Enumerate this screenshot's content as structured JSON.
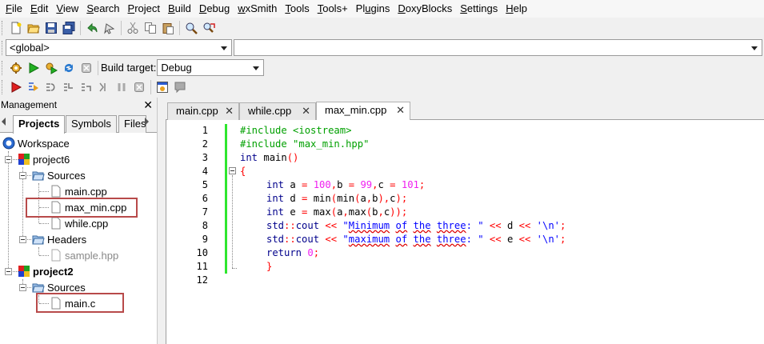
{
  "menubar": [
    "File",
    "Edit",
    "View",
    "Search",
    "Project",
    "Build",
    "Debug",
    "wxSmith",
    "Tools",
    "Tools+",
    "Plugins",
    "DoxyBlocks",
    "Settings",
    "Help"
  ],
  "menubar_underline": [
    "F",
    "E",
    "V",
    "S",
    "P",
    "B",
    "D",
    "w",
    "T",
    "T",
    "u",
    "D",
    "S",
    "H"
  ],
  "scope_combo": "<global>",
  "symbol_combo": "",
  "build_target_label": "Build target:",
  "build_target_value": "Debug",
  "management": {
    "title": "Management",
    "close": "✕",
    "tabs": [
      "Projects",
      "Symbols",
      "Files"
    ],
    "active_tab": "Projects"
  },
  "tree": {
    "workspace": "Workspace",
    "project6": "project6",
    "sources1": "Sources",
    "file_main_cpp": "main.cpp",
    "file_max_min_cpp": "max_min.cpp",
    "file_while_cpp": "while.cpp",
    "headers": "Headers",
    "file_sample_hpp": "sample.hpp",
    "project2": "project2",
    "sources2": "Sources",
    "file_main_c": "main.c"
  },
  "editor_tabs": [
    {
      "label": "main.cpp",
      "active": false
    },
    {
      "label": "while.cpp",
      "active": false
    },
    {
      "label": "max_min.cpp",
      "active": true
    }
  ],
  "tab_close": "✕",
  "line_numbers": [
    "1",
    "2",
    "3",
    "4",
    "5",
    "6",
    "7",
    "8",
    "9",
    "10",
    "11",
    "12"
  ],
  "code": {
    "l1a": "#include ",
    "l1b": "<iostream>",
    "l2a": "#include ",
    "l2b": "\"max_min.hpp\"",
    "l3a": "int",
    "l3b": " main",
    "l3c": "()",
    "l4": "{",
    "l5a": "int",
    "l5b": " a ",
    "l5c": "=",
    "l5d": "100",
    "l5e": ",",
    "l5f": "b ",
    "l5g": "=",
    "l5h": "99",
    "l5i": ",",
    "l5j": "c ",
    "l5k": "=",
    "l5l": "101",
    "l5m": ";",
    "l6a": "int",
    "l6b": " d ",
    "l6c": "=",
    "l6d": " min",
    "l6e": "(",
    "l6f": "min",
    "l6g": "(",
    "l6h": "a",
    "l6i": ",",
    "l6j": "b",
    "l6k": "),",
    "l6l": "c",
    "l6m": ");",
    "l7a": "int",
    "l7b": " e ",
    "l7c": "=",
    "l7d": " max",
    "l7e": "(",
    "l7f": "a",
    "l7g": ",",
    "l7h": "max",
    "l7i": "(",
    "l7j": "b",
    "l7k": ",",
    "l7l": "c",
    "l7m": "));",
    "l8a": "std",
    "l8b": "::",
    "l8c": "cout ",
    "l8d": "<<",
    "l8e": " \"",
    "l8f": "Minimum",
    "l8g": " ",
    "l8h": "of",
    "l8i": " ",
    "l8j": "the",
    "l8k": " ",
    "l8l": "three",
    "l8m": ": \" ",
    "l8n": "<<",
    "l8o": " d ",
    "l8p": "<<",
    "l8q": " '\\n'",
    "l8r": ";",
    "l9a": "std",
    "l9b": "::",
    "l9c": "cout ",
    "l9d": "<<",
    "l9e": " \"",
    "l9f": "maximum",
    "l9g": " ",
    "l9h": "of",
    "l9i": " ",
    "l9j": "the",
    "l9k": " ",
    "l9l": "three",
    "l9m": ": \" ",
    "l9n": "<<",
    "l9o": " e ",
    "l9p": "<<",
    "l9q": " '\\n'",
    "l9r": ";",
    "l10a": "return",
    "l10b": " 0",
    "l10c": ";",
    "l11": "}"
  },
  "icons": [
    "new-file-icon",
    "open-icon",
    "save-icon",
    "save-all-icon",
    "undo-icon",
    "redo-icon",
    "cut-icon",
    "copy-icon",
    "paste-icon",
    "find-icon",
    "replace-icon",
    "settings-icon",
    "run-icon",
    "build-run-icon",
    "rebuild-icon",
    "abort-icon",
    "debug-icon",
    "run-to-cursor-icon",
    "next-line-icon",
    "step-into-icon",
    "step-out-icon",
    "next-instruction-icon",
    "break-icon",
    "stop-debug-icon",
    "debug-windows-icon",
    "info-icon",
    "workspace-icon",
    "project-icon",
    "folder-icon",
    "file-icon"
  ],
  "colors": {
    "highlight_box": "#b84a4a",
    "change_bar": "#2ee62e",
    "keyword": "#00008b",
    "preprocessor": "#00a000",
    "number": "#f020f0",
    "string": "#0000ff",
    "operator": "#ff0000"
  }
}
